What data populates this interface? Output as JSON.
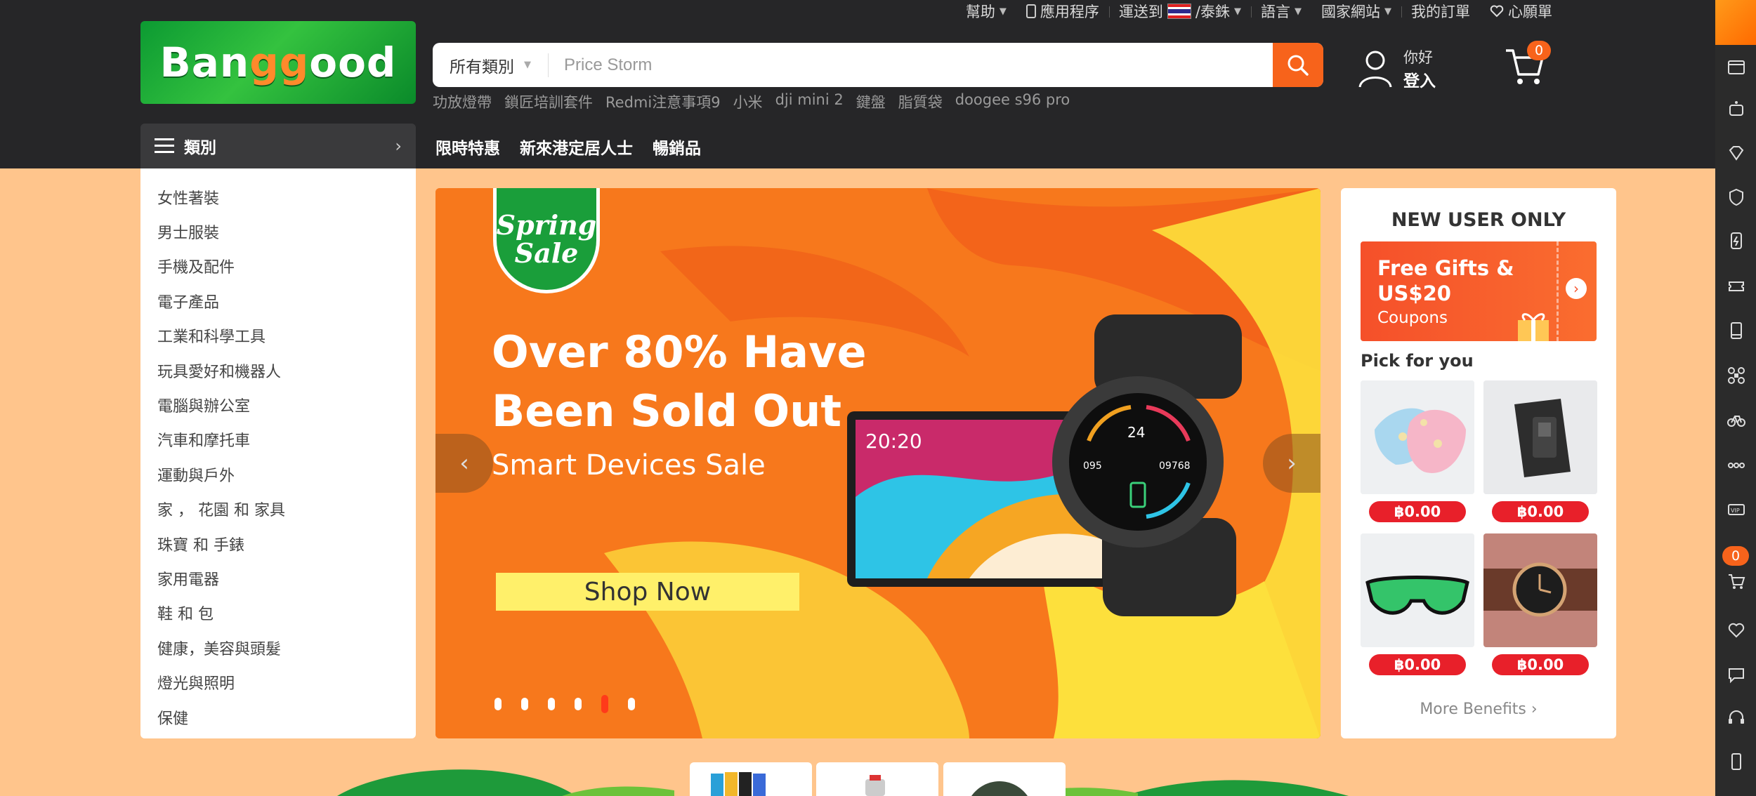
{
  "topbar": {
    "help": "幫助",
    "app": "應用程序",
    "ship_to": "運送到",
    "currency": "/泰銖",
    "language": "語言",
    "country_site": "國家網站",
    "my_orders": "我的訂單",
    "wishlist": "心願單"
  },
  "logo": {
    "text_a": "Ban",
    "text_b": "gg",
    "text_c": "ood"
  },
  "search": {
    "category": "所有類別",
    "placeholder": "Price Storm"
  },
  "hotwords": [
    "功放燈帶",
    "鎖匠培訓套件",
    "Redmi注意事項9",
    "小米",
    "dji mini 2",
    "鍵盤",
    "脂質袋",
    "doogee s96 pro"
  ],
  "account": {
    "hello": "你好",
    "login": "登入"
  },
  "cart": {
    "count": "0"
  },
  "catbar": {
    "label": "類別"
  },
  "nav": [
    "限時特惠",
    "新來港定居人士",
    "暢銷品"
  ],
  "categories": [
    "女性著裝",
    "男士服裝",
    "手機及配件",
    "電子產品",
    "工業和科學工具",
    "玩具愛好和機器人",
    "電腦與辦公室",
    "汽車和摩托車",
    "運動與戶外",
    "家 ， 花園 和 家具",
    "珠寶 和 手錶",
    "家用電器",
    "鞋 和 包",
    "健康，美容與頭髮",
    "燈光與照明",
    "保健"
  ],
  "banner": {
    "badge_line1": "Spring",
    "badge_line2": "Sale",
    "headline1": "Over 80% Have",
    "headline2": "Been Sold Out",
    "subline": "Smart Devices Sale",
    "cta": "Shop Now",
    "tablet_time": "20:20",
    "watch_top": "24",
    "watch_left": "095",
    "watch_right": "09768",
    "slide_count": 6,
    "active_slide": 5
  },
  "side": {
    "title": "NEW USER ONLY",
    "coupon_line1": "Free Gifts &",
    "coupon_line2": "US$20",
    "coupon_line3": "Coupons",
    "pick": "Pick for you",
    "prices": [
      "฿0.00",
      "฿0.00",
      "฿0.00",
      "฿0.00"
    ],
    "more": "More Benefits ›"
  },
  "rail": {
    "cart_count": "0"
  },
  "colors": {
    "accent": "#f7631b",
    "header": "#262628",
    "page_bg": "#ffc58c",
    "price_red": "#e8202a"
  }
}
